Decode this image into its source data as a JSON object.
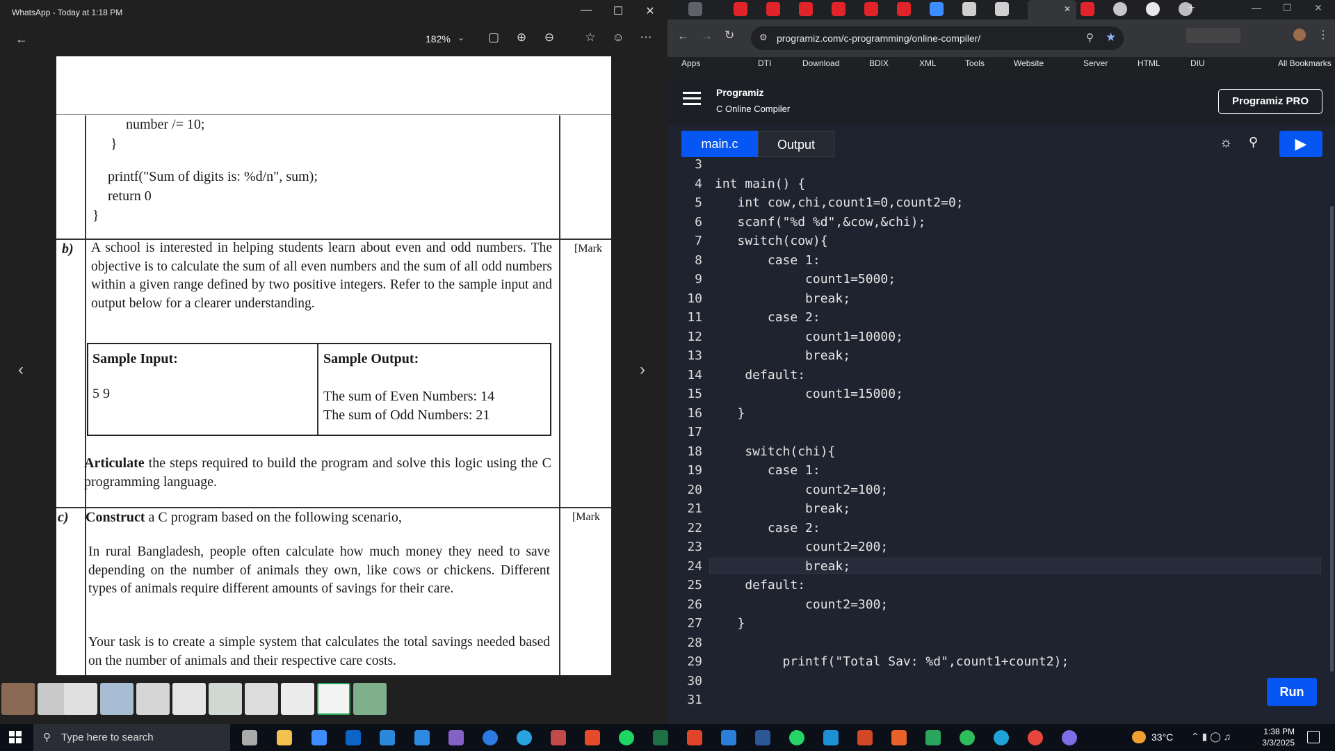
{
  "whatsapp": {
    "title": "WhatsApp - Today at 1:18 PM",
    "zoom": "182%",
    "window_controls": [
      "—",
      "☐",
      "✕"
    ]
  },
  "document": {
    "code_lines": [
      "number /= 10;",
      "}",
      "printf(\"Sum of digits is: %d/n\", sum);",
      "return 0",
      "}"
    ],
    "b_label": "b)",
    "b_text": "A school is interested in helping students learn about even and odd numbers. The objective is to calculate the sum of all even numbers and the sum of all odd numbers within a given range defined by two positive integers. Refer to the sample input and output below for a clearer understanding.",
    "marks_b": "[Mark",
    "sample_input_h": "Sample Input:",
    "sample_output_h": "Sample Output:",
    "sample_input_v": "5 9",
    "sample_output_1": "The sum of Even Numbers: 14",
    "sample_output_2": "The sum of Odd Numbers: 21",
    "articulate_bold": "Articulate",
    "articulate_rest": " the steps required to build the program and solve this logic using the C programming language.",
    "c_label": "c)",
    "construct_bold": "Construct",
    "construct_rest": " a C program based on the following scenario,",
    "marks_c": "[Mark",
    "scenario_1": "In rural Bangladesh, people often calculate how much money they need to save depending on the number of animals they own, like cows or chickens. Different types of animals require different amounts of savings for their care.",
    "scenario_2": "Your task is to create a simple system that calculates the total savings needed based on the number of animals and their respective care costs."
  },
  "chrome": {
    "url": "programiz.com/c-programming/online-compiler/",
    "bookmarks": [
      "Apps",
      "DTI",
      "Download",
      "BDIX",
      "XML",
      "Tools",
      "Website",
      "Server",
      "HTML",
      "DIU",
      "All Bookmarks"
    ]
  },
  "programiz": {
    "logo": "Programiz",
    "subtitle": "C Online Compiler",
    "pro_button": "Programiz PRO",
    "tab_main": "main.c",
    "tab_output": "Output",
    "run_label": "Run"
  },
  "code": [
    {
      "n": "3",
      "t": ""
    },
    {
      "n": "4",
      "t": "int main() {"
    },
    {
      "n": "5",
      "t": "   int cow,chi,count1=0,count2=0;"
    },
    {
      "n": "6",
      "t": "   scanf(\"%d %d\",&cow,&chi);"
    },
    {
      "n": "7",
      "t": "   switch(cow){"
    },
    {
      "n": "8",
      "t": "       case 1:"
    },
    {
      "n": "9",
      "t": "            count1=5000;"
    },
    {
      "n": "10",
      "t": "            break;"
    },
    {
      "n": "11",
      "t": "       case 2:"
    },
    {
      "n": "12",
      "t": "            count1=10000;"
    },
    {
      "n": "13",
      "t": "            break;"
    },
    {
      "n": "14",
      "t": "    default:"
    },
    {
      "n": "15",
      "t": "            count1=15000;"
    },
    {
      "n": "16",
      "t": "   }"
    },
    {
      "n": "17",
      "t": ""
    },
    {
      "n": "18",
      "t": "    switch(chi){"
    },
    {
      "n": "19",
      "t": "       case 1:"
    },
    {
      "n": "20",
      "t": "            count2=100;"
    },
    {
      "n": "21",
      "t": "            break;"
    },
    {
      "n": "22",
      "t": "       case 2:"
    },
    {
      "n": "23",
      "t": "            count2=200;"
    },
    {
      "n": "24",
      "t": "            break;"
    },
    {
      "n": "25",
      "t": "    default:"
    },
    {
      "n": "26",
      "t": "            count2=300;"
    },
    {
      "n": "27",
      "t": "   }"
    },
    {
      "n": "28",
      "t": ""
    },
    {
      "n": "29",
      "t": "         printf(\"Total Sav: %d\",count1+count2);"
    },
    {
      "n": "30",
      "t": ""
    },
    {
      "n": "31",
      "t": ""
    }
  ],
  "taskbar": {
    "search_placeholder": "Type here to search",
    "temperature": "33°C",
    "time": "1:38 PM",
    "date": "3/3/2025"
  },
  "colors": {
    "accent": "#0556f3",
    "editor_bg": "#1f2330",
    "number": "#ff7b54"
  }
}
